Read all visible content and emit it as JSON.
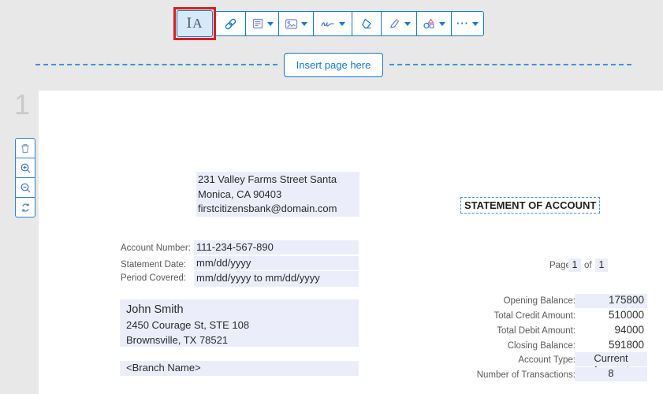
{
  "colors": {
    "accent_blue": "#1677d0",
    "selected_tool_bg": "#d6e9f8",
    "annotation_red": "#d6201f",
    "field_highlight_bg": "#ebeefa",
    "dashed_line_blue": "#4290dc",
    "canvas_bg": "#e8e8e8",
    "label_gray": "#595959",
    "page_number_gray": "#c9c9c9"
  },
  "toolbar": {
    "text_tool_label": "ⅠA",
    "buttons": [
      {
        "name": "text-tool",
        "selected": true,
        "annotated": true
      },
      {
        "name": "link-tool"
      },
      {
        "name": "form-tool",
        "dropdown": true
      },
      {
        "name": "image-tool",
        "dropdown": true
      },
      {
        "name": "signature-tool",
        "dropdown": true
      },
      {
        "name": "eraser-tool"
      },
      {
        "name": "highlighter-tool",
        "dropdown": true
      },
      {
        "name": "shapes-tool",
        "dropdown": true
      },
      {
        "name": "more-tools",
        "dropdown": true
      }
    ]
  },
  "insert_page": {
    "label": "Insert page here"
  },
  "page_panel": {
    "page_number": "1",
    "tools": [
      "delete-page",
      "zoom-in",
      "zoom-out",
      "rotate-page"
    ]
  },
  "document": {
    "bank_address": {
      "line1": "231 Valley Farms Street Santa",
      "line2": "Monica, CA 90403",
      "line3": "firstcitizensbank@domain.com"
    },
    "title": "STATEMENT OF ACCOUNT",
    "fields": [
      {
        "label": "Account Number:",
        "value": "111-234-567-890"
      },
      {
        "label": "Statement Date:",
        "value": "mm/dd/yyyy"
      },
      {
        "label": "Period Covered:",
        "value": "mm/dd/yyyy to mm/dd/yyyy"
      }
    ],
    "page_indicator": {
      "prefix": "Page",
      "current": "1",
      "middle": "of",
      "total": "1"
    },
    "customer": {
      "name": "John Smith",
      "address1": "2450 Courage St, STE 108",
      "address2": "Brownsville, TX 78521"
    },
    "branch": "<Branch Name>",
    "summary": [
      {
        "label": "Opening Balance:",
        "value": "175800",
        "highlighted": true
      },
      {
        "label": "Total Credit Amount:",
        "value": "510000",
        "highlighted": false
      },
      {
        "label": "Total Debit Amount:",
        "value": "94000",
        "highlighted": false
      },
      {
        "label": "Closing Balance:",
        "value": "591800",
        "highlighted": false
      },
      {
        "label": "Account Type:",
        "value": "Current Account",
        "highlighted": true
      },
      {
        "label": "Number of Transactions:",
        "value": "8",
        "highlighted": true
      }
    ]
  }
}
